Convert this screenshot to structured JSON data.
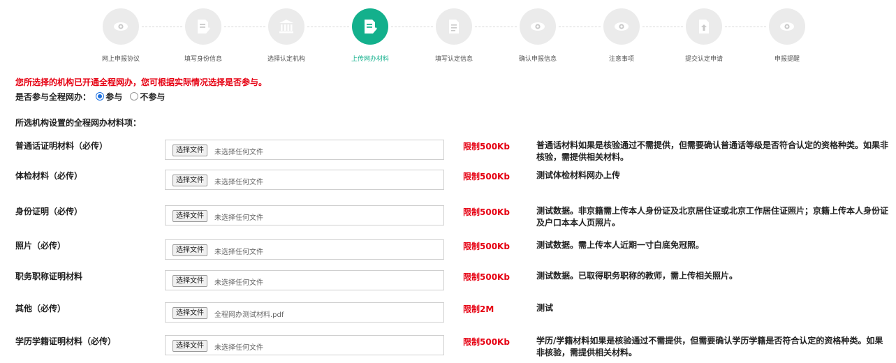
{
  "steps": [
    {
      "label": "网上申报协议",
      "icon": "eye-icon",
      "active": false
    },
    {
      "label": "填写身份信息",
      "icon": "document-edit-icon",
      "active": false
    },
    {
      "label": "选择认定机构",
      "icon": "institution-icon",
      "active": false
    },
    {
      "label": "上传网办材料",
      "icon": "document-edit-icon",
      "active": true
    },
    {
      "label": "填写认定信息",
      "icon": "document-icon",
      "active": false
    },
    {
      "label": "确认申报信息",
      "icon": "eye-icon",
      "active": false
    },
    {
      "label": "注意事项",
      "icon": "eye-icon",
      "active": false
    },
    {
      "label": "提交认定申请",
      "icon": "file-upload-icon",
      "active": false
    },
    {
      "label": "申报提醒",
      "icon": "eye-icon",
      "active": false
    }
  ],
  "colors": {
    "accent": "#13b08c",
    "alert": "#e60012",
    "inactive_step": "#ebebeb"
  },
  "notice": "您所选择的机构已开通全程网办，您可根据实际情况选择是否参与。",
  "participation": {
    "label": "是否参与全程网办：",
    "options": [
      "参与",
      "不参与"
    ],
    "selected": "参与"
  },
  "materials_title": "所选机构设置的全程网办材料项：",
  "materials": [
    {
      "label": "普通话证明材料（必传）",
      "button": "选择文件",
      "file": "未选择任何文件",
      "limit": "限制500Kb",
      "desc": "普通话材料如果是核验通过不需提供，但需要确认普通话等级是否符合认定的资格种类。如果非核验，需提供相关材料。"
    },
    {
      "label": "体检材料（必传）",
      "button": "选择文件",
      "file": "未选择任何文件",
      "limit": "限制500Kb",
      "desc": "测试体检材料网办上传"
    },
    {
      "label": "身份证明（必传）",
      "button": "选择文件",
      "file": "未选择任何文件",
      "limit": "限制500Kb",
      "desc": "测试数据。非京籍需上传本人身份证及北京居住证或北京工作居住证照片；京籍上传本人身份证及户口本本人页照片。"
    },
    {
      "label": "照片（必传）",
      "button": "选择文件",
      "file": "未选择任何文件",
      "limit": "限制500Kb",
      "desc": "测试数据。需上传本人近期一寸白底免冠照。"
    },
    {
      "label": "职务职称证明材料",
      "button": "选择文件",
      "file": "未选择任何文件",
      "limit": "限制500Kb",
      "desc": "测试数据。已取得职务职称的教师，需上传相关照片。"
    },
    {
      "label": "其他（必传）",
      "button": "选择文件",
      "file": "全程网办测试材料.pdf",
      "limit": "限制2M",
      "desc": "测试"
    },
    {
      "label": "学历学籍证明材料（必传）",
      "button": "选择文件",
      "file": "未选择任何文件",
      "limit": "限制500Kb",
      "desc": "学历/学籍材料如果是核验通过不需提供，但需要确认学历学籍是否符合认定的资格种类。如果非核验，需提供相关材料。"
    }
  ]
}
